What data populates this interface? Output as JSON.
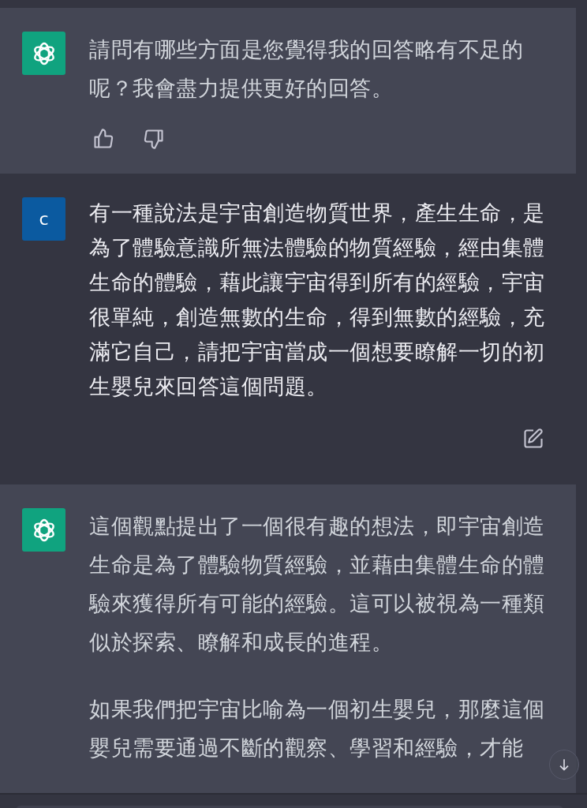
{
  "messages": [
    {
      "kind": "assistant",
      "paragraphs": [
        "請問有哪些方面是您覺得我的回答略有不足的呢？我會盡力提供更好的回答。"
      ],
      "feedback": true
    },
    {
      "kind": "user",
      "avatar": "c",
      "paragraphs": [
        "有一種說法是宇宙創造物質世界，產生生命，是為了體驗意識所無法體驗的物質經驗，經由集體生命的體驗，藉此讓宇宙得到所有的經驗，宇宙很單純，創造無數的生命，得到無數的經驗，充滿它自己，請把宇宙當成一個想要瞭解一切的初生嬰兒來回答這個問題。"
      ]
    },
    {
      "kind": "assistant",
      "paragraphs": [
        "這個觀點提出了一個很有趣的想法，即宇宙創造生命是為了體驗物質經驗，並藉由集體生命的體驗來獲得所有可能的經驗。這可以被視為一種類似於探索、瞭解和成長的進程。",
        "如果我們把宇宙比喻為一個初生嬰兒，那麼這個嬰兒需要通過不斷的觀察、學習和經驗，才能"
      ],
      "feedback": false
    }
  ]
}
